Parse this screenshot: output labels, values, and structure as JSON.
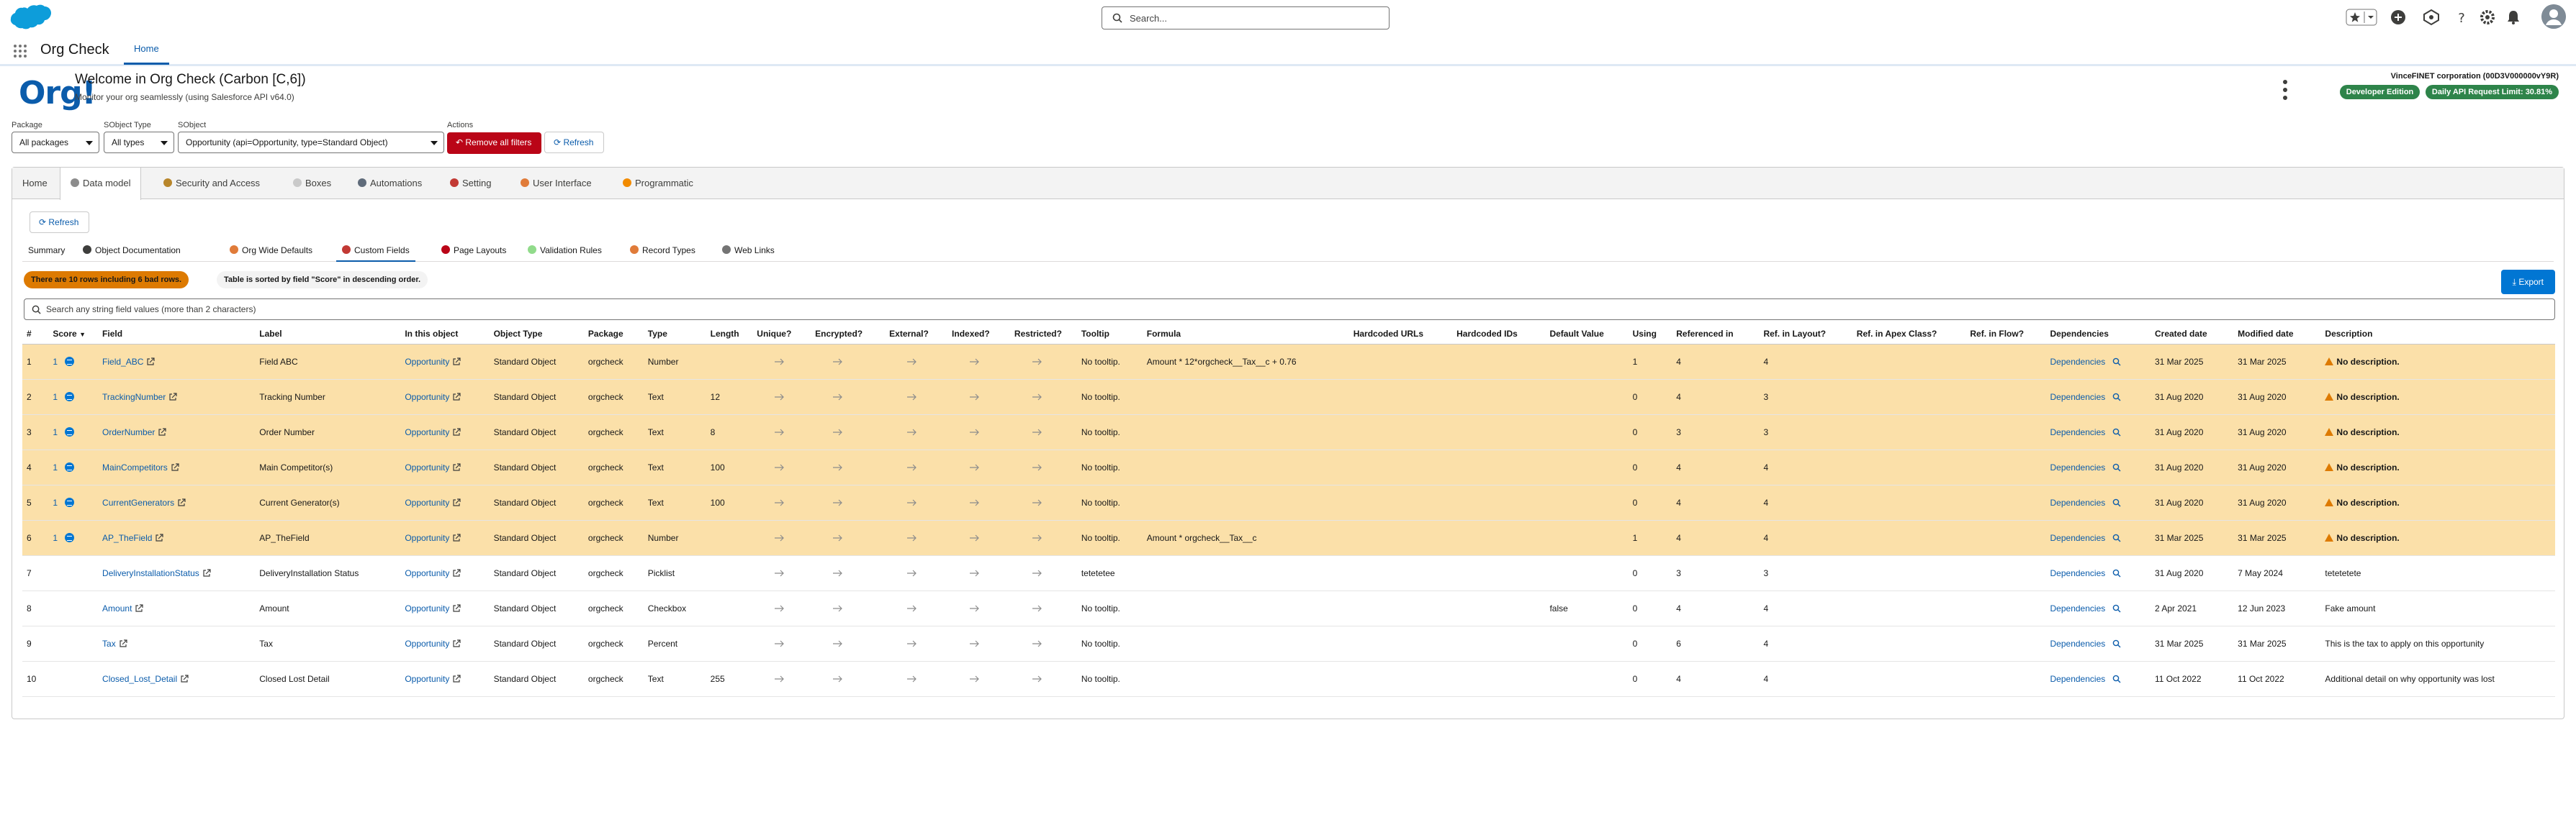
{
  "header": {
    "search_placeholder": "Search...",
    "app_name": "Org Check",
    "nav_tab": "Home"
  },
  "page": {
    "logo_text": "Org!",
    "welcome": "Welcome in Org Check (Carbon [C,6])",
    "subtitle": "Monitor your org seamlessly (using Salesforce API v64.0)",
    "org_name": "VinceFINET corporation (00D3V000000vY9R)",
    "edition_badge": "Developer Edition",
    "api_badge": "Daily API Request Limit: 30.81%"
  },
  "filters": {
    "package_label": "Package",
    "package_value": "All packages",
    "sobject_type_label": "SObject Type",
    "sobject_type_value": "All types",
    "sobject_label": "SObject",
    "sobject_value": "Opportunity (api=Opportunity, type=Standard Object)",
    "actions_label": "Actions",
    "remove_filters": "Remove all filters",
    "refresh": "Refresh"
  },
  "main_tabs": [
    "Home",
    "Data model",
    "Security and Access",
    "Boxes",
    "Automations",
    "Setting",
    "User Interface",
    "Programmatic"
  ],
  "content": {
    "refresh": "Refresh",
    "sub_tabs": [
      "Summary",
      "Object Documentation",
      "Org Wide Defaults",
      "Custom Fields",
      "Page Layouts",
      "Validation Rules",
      "Record Types",
      "Web Links"
    ],
    "bad_rows_pill": "There are 10 rows including 6 bad rows.",
    "sort_pill": "Table is sorted by field \"Score\" in descending order.",
    "export": "Export",
    "table_search_placeholder": "Search any string field values (more than 2 characters)"
  },
  "table": {
    "columns": [
      "#",
      "Score",
      "Field",
      "Label",
      "In this object",
      "Object Type",
      "Package",
      "Type",
      "Length",
      "Unique?",
      "Encrypted?",
      "External?",
      "Indexed?",
      "Restricted?",
      "Tooltip",
      "Formula",
      "Hardcoded URLs",
      "Hardcoded IDs",
      "Default Value",
      "Using",
      "Referenced in",
      "Ref. in Layout?",
      "Ref. in Apex Class?",
      "Ref. in Flow?",
      "Dependencies",
      "Created date",
      "Modified date",
      "Description"
    ],
    "rows": [
      {
        "n": "1",
        "score": "1",
        "field": "Field_ABC",
        "label": "Field ABC",
        "obj": "Opportunity",
        "otype": "Standard Object",
        "pkg": "orgcheck",
        "type": "Number",
        "length": "",
        "tooltip": "No tooltip.",
        "formula": "Amount * 12*orgcheck__Tax__c + 0.76",
        "default": "",
        "using": "1",
        "ref": "4",
        "layout": "4",
        "deps": "Dependencies",
        "created": "31 Mar 2025",
        "modified": "31 Mar 2025",
        "desc": "No description.",
        "bad": true
      },
      {
        "n": "2",
        "score": "1",
        "field": "TrackingNumber",
        "label": "Tracking Number",
        "obj": "Opportunity",
        "otype": "Standard Object",
        "pkg": "orgcheck",
        "type": "Text",
        "length": "12",
        "tooltip": "No tooltip.",
        "formula": "",
        "default": "",
        "using": "0",
        "ref": "4",
        "layout": "3",
        "deps": "Dependencies",
        "created": "31 Aug 2020",
        "modified": "31 Aug 2020",
        "desc": "No description.",
        "bad": true
      },
      {
        "n": "3",
        "score": "1",
        "field": "OrderNumber",
        "label": "Order Number",
        "obj": "Opportunity",
        "otype": "Standard Object",
        "pkg": "orgcheck",
        "type": "Text",
        "length": "8",
        "tooltip": "No tooltip.",
        "formula": "",
        "default": "",
        "using": "0",
        "ref": "3",
        "layout": "3",
        "deps": "Dependencies",
        "created": "31 Aug 2020",
        "modified": "31 Aug 2020",
        "desc": "No description.",
        "bad": true
      },
      {
        "n": "4",
        "score": "1",
        "field": "MainCompetitors",
        "label": "Main Competitor(s)",
        "obj": "Opportunity",
        "otype": "Standard Object",
        "pkg": "orgcheck",
        "type": "Text",
        "length": "100",
        "tooltip": "No tooltip.",
        "formula": "",
        "default": "",
        "using": "0",
        "ref": "4",
        "layout": "4",
        "deps": "Dependencies",
        "created": "31 Aug 2020",
        "modified": "31 Aug 2020",
        "desc": "No description.",
        "bad": true
      },
      {
        "n": "5",
        "score": "1",
        "field": "CurrentGenerators",
        "label": "Current Generator(s)",
        "obj": "Opportunity",
        "otype": "Standard Object",
        "pkg": "orgcheck",
        "type": "Text",
        "length": "100",
        "tooltip": "No tooltip.",
        "formula": "",
        "default": "",
        "using": "0",
        "ref": "4",
        "layout": "4",
        "deps": "Dependencies",
        "created": "31 Aug 2020",
        "modified": "31 Aug 2020",
        "desc": "No description.",
        "bad": true
      },
      {
        "n": "6",
        "score": "1",
        "field": "AP_TheField",
        "label": "AP_TheField",
        "obj": "Opportunity",
        "otype": "Standard Object",
        "pkg": "orgcheck",
        "type": "Number",
        "length": "",
        "tooltip": "No tooltip.",
        "formula": "Amount * orgcheck__Tax__c",
        "default": "",
        "using": "1",
        "ref": "4",
        "layout": "4",
        "deps": "Dependencies",
        "created": "31 Mar 2025",
        "modified": "31 Mar 2025",
        "desc": "No description.",
        "bad": true
      },
      {
        "n": "7",
        "score": "",
        "field": "DeliveryInstallationStatus",
        "label": "DeliveryInstallation Status",
        "obj": "Opportunity",
        "otype": "Standard Object",
        "pkg": "orgcheck",
        "type": "Picklist",
        "length": "",
        "tooltip": "tetetetee",
        "formula": "",
        "default": "",
        "using": "0",
        "ref": "3",
        "layout": "3",
        "deps": "Dependencies",
        "created": "31 Aug 2020",
        "modified": "7 May 2024",
        "desc": "tetetetete",
        "bad": false
      },
      {
        "n": "8",
        "score": "",
        "field": "Amount",
        "label": "Amount",
        "obj": "Opportunity",
        "otype": "Standard Object",
        "pkg": "orgcheck",
        "type": "Checkbox",
        "length": "",
        "tooltip": "No tooltip.",
        "formula": "",
        "default": "false",
        "using": "0",
        "ref": "4",
        "layout": "4",
        "deps": "Dependencies",
        "created": "2 Apr 2021",
        "modified": "12 Jun 2023",
        "desc": "Fake amount",
        "bad": false
      },
      {
        "n": "9",
        "score": "",
        "field": "Tax",
        "label": "Tax",
        "obj": "Opportunity",
        "otype": "Standard Object",
        "pkg": "orgcheck",
        "type": "Percent",
        "length": "",
        "tooltip": "No tooltip.",
        "formula": "",
        "default": "",
        "using": "0",
        "ref": "6",
        "layout": "4",
        "deps": "Dependencies",
        "created": "31 Mar 2025",
        "modified": "31 Mar 2025",
        "desc": "This is the tax to apply on this opportunity",
        "bad": false
      },
      {
        "n": "10",
        "score": "",
        "field": "Closed_Lost_Detail",
        "label": "Closed Lost Detail",
        "obj": "Opportunity",
        "otype": "Standard Object",
        "pkg": "orgcheck",
        "type": "Text",
        "length": "255",
        "tooltip": "No tooltip.",
        "formula": "",
        "default": "",
        "using": "0",
        "ref": "4",
        "layout": "4",
        "deps": "Dependencies",
        "created": "11 Oct 2022",
        "modified": "11 Oct 2022",
        "desc": "Additional detail on why opportunity was lost",
        "bad": false
      }
    ]
  },
  "colors": {
    "brand": "#0b5cab",
    "danger": "#ba0517",
    "warning": "#dd7a01",
    "bad_row": "#fbe0a9",
    "success": "#2e844a"
  }
}
